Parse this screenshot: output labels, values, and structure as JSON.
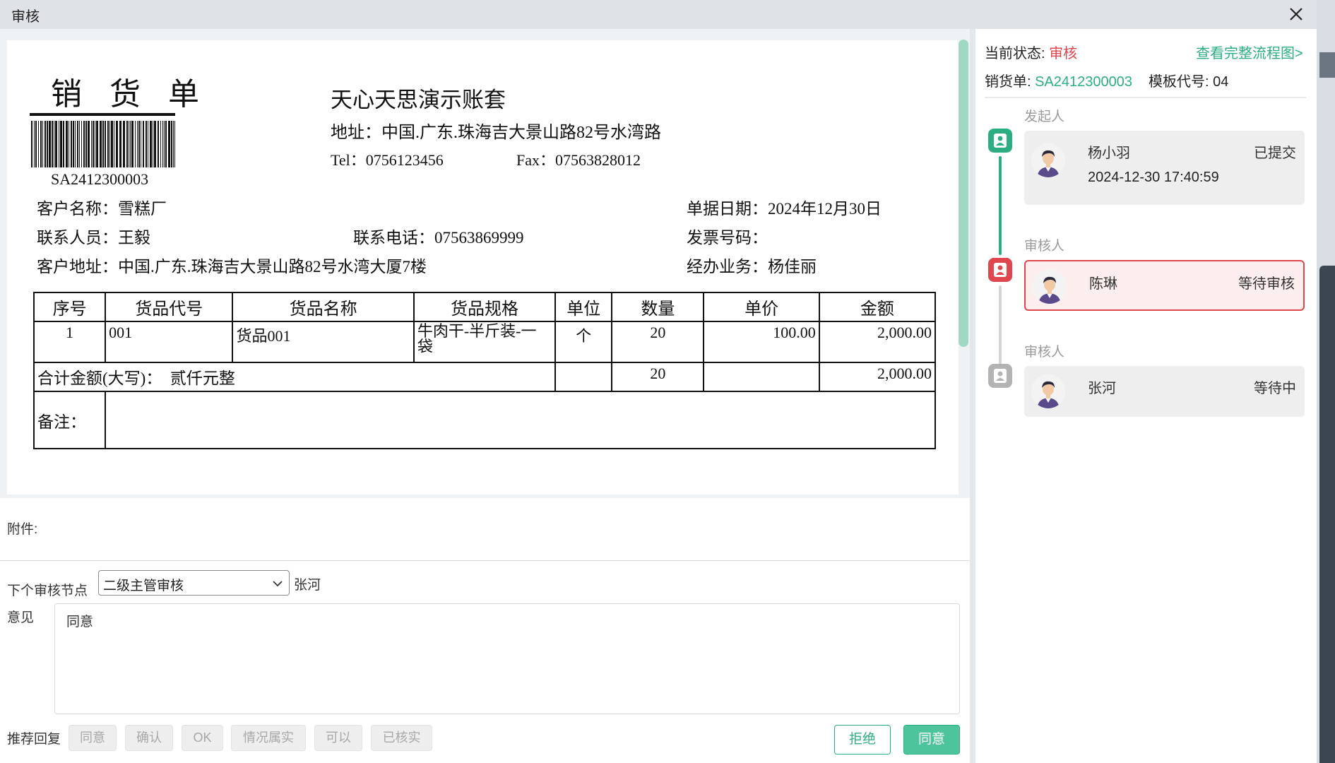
{
  "window": {
    "title": "审核"
  },
  "document": {
    "title": "销 货 单",
    "barcode_number": "SA2412300003",
    "company": "天心天思演示账套",
    "address": "地址：中国.广东.珠海吉大景山路82号水湾路",
    "tel": "Tel：0756123456",
    "fax": "Fax：07563828012",
    "customer_name": "客户名称：雪糕厂",
    "bill_date": "单据日期：2024年12月30日",
    "contact": "联系人员：王毅",
    "contact_phone": "联系电话：07563869999",
    "invoice_no": "发票号码：",
    "customer_address": "客户地址：中国.广东.珠海吉大景山路82号水湾大厦7楼",
    "salesperson": "经办业务：杨佳丽",
    "table": {
      "headers": [
        "序号",
        "货品代号",
        "货品名称",
        "货品规格",
        "单位",
        "数量",
        "单价",
        "金额"
      ],
      "rows": [
        [
          "1",
          "001",
          "货品001",
          "牛肉干-半斤装-一袋",
          "个",
          "20",
          "100.00",
          "2,000.00"
        ]
      ],
      "total_label": "合计金额(大写)：  贰仟元整",
      "total_qty": "20",
      "total_amount": "2,000.00",
      "remark_label": "备注："
    }
  },
  "attachments_label": "附件:",
  "next_node": {
    "label": "下个审核节点",
    "selected": "二级主管审核",
    "assignee": "张河"
  },
  "opinion": {
    "label": "意见",
    "value": "同意"
  },
  "recommend": {
    "label": "推荐回复",
    "options": [
      "同意",
      "确认",
      "OK",
      "情况属实",
      "可以",
      "已核实"
    ]
  },
  "actions": {
    "reject": "拒绝",
    "agree": "同意"
  },
  "panel": {
    "status_label": "当前状态:",
    "status_value": "审核",
    "flow_link": "查看完整流程图>",
    "bill_label": "销货单:",
    "bill_no": "SA2412300003",
    "template_label": "模板代号:",
    "template_no": "04",
    "steps": [
      {
        "role": "发起人",
        "name": "杨小羽",
        "state": "已提交",
        "time": "2024-12-30 17:40:59",
        "icon_color": "#2cae82"
      },
      {
        "role": "审核人",
        "name": "陈琳",
        "state": "等待审核",
        "icon_color": "#e0464e"
      },
      {
        "role": "审核人",
        "name": "张河",
        "state": "等待中",
        "icon_color": "#b3b3b3"
      }
    ]
  }
}
